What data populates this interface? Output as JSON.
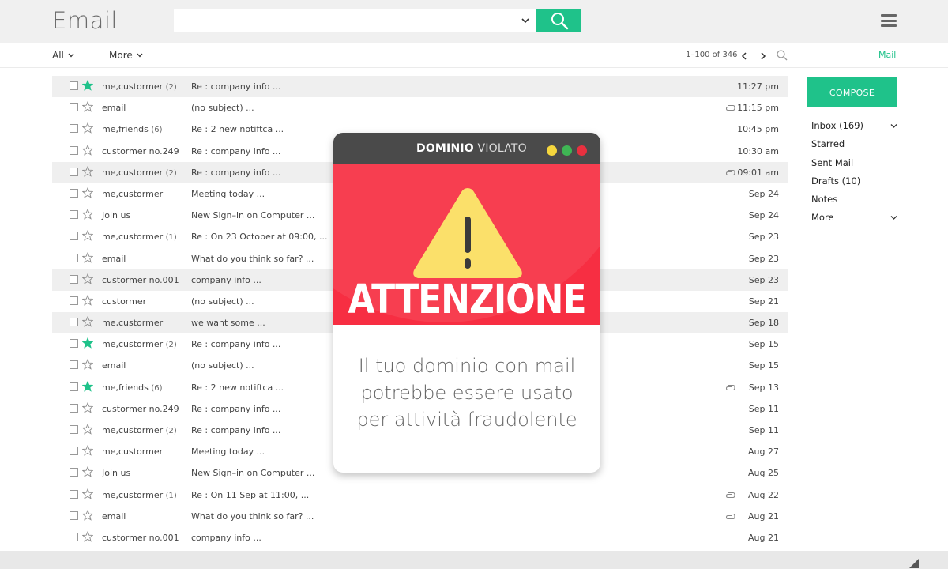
{
  "header": {
    "app_title": "Email",
    "search": {
      "placeholder": ""
    }
  },
  "toolbar": {
    "all_label": "All",
    "more_label": "More",
    "pagination": "1–100 of 346",
    "mail_link": "Mail"
  },
  "emails": [
    {
      "sender": "me,custormer",
      "count": "(2)",
      "subject": "Re : company info ...",
      "date": "11:27 pm",
      "starred": true,
      "shaded": true,
      "attachment": false
    },
    {
      "sender": "email",
      "count": "",
      "subject": "(no subject) ...",
      "date": "11:15 pm",
      "starred": false,
      "shaded": false,
      "attachment": true
    },
    {
      "sender": "me,friends",
      "count": "(6)",
      "subject": "Re : 2 new notiftca ...",
      "date": "10:45 pm",
      "starred": false,
      "shaded": false,
      "attachment": false
    },
    {
      "sender": "custormer no.249",
      "count": "",
      "subject": "Re : company info ...",
      "date": "10:30 am",
      "starred": false,
      "shaded": false,
      "attachment": false
    },
    {
      "sender": "me,custormer",
      "count": "(2)",
      "subject": "Re : company info ...",
      "date": "09:01 am",
      "starred": false,
      "shaded": true,
      "attachment": true
    },
    {
      "sender": "me,custormer",
      "count": "",
      "subject": "Meeting today ...",
      "date": "Sep 24",
      "starred": false,
      "shaded": false,
      "attachment": false
    },
    {
      "sender": "Join us",
      "count": "",
      "subject": "New Sign–in on Computer ...",
      "date": "Sep 24",
      "starred": false,
      "shaded": false,
      "attachment": false
    },
    {
      "sender": "me,custormer",
      "count": "(1)",
      "subject": "Re : On 23 October at 09:00, ...",
      "date": "Sep 23",
      "starred": false,
      "shaded": false,
      "attachment": false
    },
    {
      "sender": "email",
      "count": "",
      "subject": "What do you think so far? ...",
      "date": "Sep 23",
      "starred": false,
      "shaded": false,
      "attachment": false
    },
    {
      "sender": "custormer no.001",
      "count": "",
      "subject": "company info ...",
      "date": "Sep 23",
      "starred": false,
      "shaded": true,
      "attachment": false
    },
    {
      "sender": "custormer",
      "count": "",
      "subject": "(no subject) ...",
      "date": "Sep 21",
      "starred": false,
      "shaded": false,
      "attachment": false
    },
    {
      "sender": "me,custormer",
      "count": "",
      "subject": "we want some ...",
      "date": "Sep 18",
      "starred": false,
      "shaded": true,
      "attachment": false
    },
    {
      "sender": "me,custormer",
      "count": "(2)",
      "subject": "Re : company info ...",
      "date": "Sep 15",
      "starred": true,
      "shaded": false,
      "attachment": false
    },
    {
      "sender": "email",
      "count": "",
      "subject": "(no subject) ...",
      "date": "Sep 15",
      "starred": false,
      "shaded": false,
      "attachment": false
    },
    {
      "sender": "me,friends",
      "count": "(6)",
      "subject": "Re : 2 new notiftca ...",
      "date": "Sep 13",
      "starred": true,
      "shaded": false,
      "attachment": true
    },
    {
      "sender": "custormer no.249",
      "count": "",
      "subject": "Re : company info ...",
      "date": "Sep 11",
      "starred": false,
      "shaded": false,
      "attachment": false
    },
    {
      "sender": "me,custormer",
      "count": "(2)",
      "subject": "Re : company info ...",
      "date": "Sep 11",
      "starred": false,
      "shaded": false,
      "attachment": false
    },
    {
      "sender": "me,custormer",
      "count": "",
      "subject": "Meeting today ...",
      "date": "Aug 27",
      "starred": false,
      "shaded": false,
      "attachment": false
    },
    {
      "sender": "Join us",
      "count": "",
      "subject": "New Sign–in on Computer ...",
      "date": "Aug 25",
      "starred": false,
      "shaded": false,
      "attachment": false
    },
    {
      "sender": "me,custormer",
      "count": "(1)",
      "subject": "Re : On 11 Sep at 11:00, ...",
      "date": "Aug 22",
      "starred": false,
      "shaded": false,
      "attachment": true
    },
    {
      "sender": "email",
      "count": "",
      "subject": "What do you think so far? ...",
      "date": "Aug 21",
      "starred": false,
      "shaded": false,
      "attachment": true
    },
    {
      "sender": "custormer no.001",
      "count": "",
      "subject": "company info ...",
      "date": "Aug 21",
      "starred": false,
      "shaded": false,
      "attachment": false
    }
  ],
  "sidebar": {
    "compose_label": "COMPOSE",
    "items": [
      {
        "label": "Inbox",
        "count": "(169)",
        "chevron": true
      },
      {
        "label": "Starred",
        "count": "",
        "chevron": false
      },
      {
        "label": "Sent Mail",
        "count": "",
        "chevron": false
      },
      {
        "label": "Drafts",
        "count": "(10)",
        "chevron": false
      },
      {
        "label": "Notes",
        "count": "",
        "chevron": false
      },
      {
        "label": "More",
        "count": "",
        "chevron": true
      }
    ]
  },
  "popup": {
    "title_bold": "DOMINIO",
    "title_light": "VIOLATO",
    "headline": "ATTENZIONE",
    "body": "Il tuo dominio con mail potrebbe essere usato per attività fraudolente"
  },
  "colors": {
    "accent": "#1fc28a",
    "alert_red": "#f72e42",
    "warning_yellow": "#fbe06a",
    "titlebar": "#4a4a4a"
  },
  "icons": {
    "search": "search-icon",
    "menu": "hamburger-icon",
    "star": "star-icon",
    "attachment": "paperclip-icon",
    "warning": "warning-triangle-icon"
  }
}
